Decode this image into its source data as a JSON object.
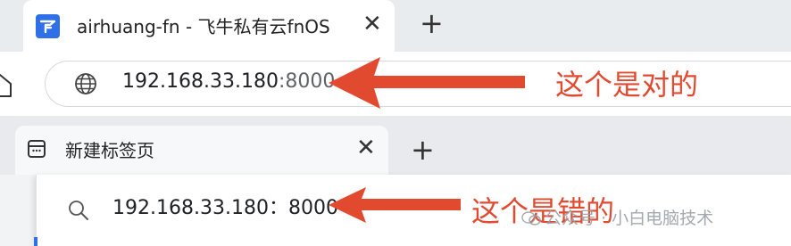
{
  "window_top": {
    "tab": {
      "title": "airhuang-fn - 飞牛私有云fnOS",
      "favicon": "fnos-logo-icon"
    },
    "address": {
      "host": "192.168.33.180",
      "port": ":8000"
    }
  },
  "window_bottom": {
    "tab": {
      "title": "新建标签页",
      "icon": "new-tab-page-icon"
    },
    "address": {
      "text": "192.168.33.180：8000"
    }
  },
  "annotations": {
    "correct_label": "这个是对的",
    "wrong_label": "这个是错的",
    "color": "#e24a30"
  },
  "watermark": {
    "text": "公众号 · 小白电脑技术"
  },
  "colors": {
    "accent_blue": "#2f6fe8",
    "tabstrip": "#e9ecef"
  }
}
